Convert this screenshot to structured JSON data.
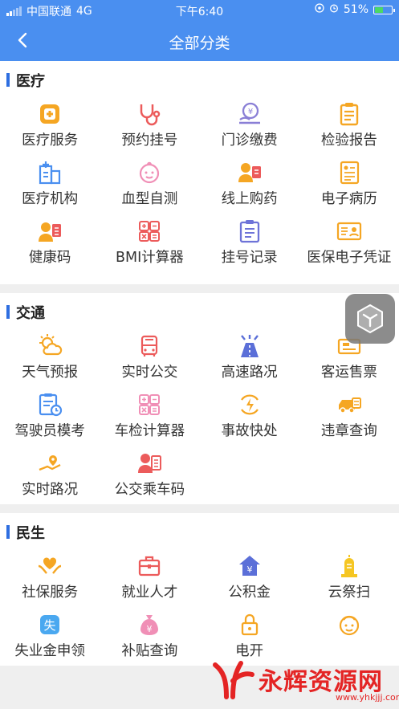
{
  "status": {
    "carrier": "中国联通",
    "network": "4G",
    "time": "下午6:40",
    "battery": "51%",
    "battery_level": 0.51
  },
  "nav": {
    "title": "全部分类"
  },
  "sections": [
    {
      "name": "医疗",
      "items": [
        {
          "label": "医疗服务",
          "icon": "medical-box-icon"
        },
        {
          "label": "预约挂号",
          "icon": "stethoscope-icon"
        },
        {
          "label": "门诊缴费",
          "icon": "payment-icon"
        },
        {
          "label": "检验报告",
          "icon": "report-icon"
        },
        {
          "label": "医疗机构",
          "icon": "hospital-icon"
        },
        {
          "label": "血型自测",
          "icon": "baby-face-icon"
        },
        {
          "label": "线上购药",
          "icon": "pharmacist-icon"
        },
        {
          "label": "电子病历",
          "icon": "record-icon"
        },
        {
          "label": "健康码",
          "icon": "health-code-icon"
        },
        {
          "label": "BMI计算器",
          "icon": "calculator-icon"
        },
        {
          "label": "挂号记录",
          "icon": "clipboard-icon"
        },
        {
          "label": "医保电子凭证",
          "icon": "insurance-card-icon"
        }
      ]
    },
    {
      "name": "交通",
      "items": [
        {
          "label": "天气预报",
          "icon": "weather-icon"
        },
        {
          "label": "实时公交",
          "icon": "bus-icon"
        },
        {
          "label": "高速路况",
          "icon": "highway-icon"
        },
        {
          "label": "客运售票",
          "icon": "ticket-icon"
        },
        {
          "label": "驾驶员模考",
          "icon": "exam-icon"
        },
        {
          "label": "车检计算器",
          "icon": "calculator-icon"
        },
        {
          "label": "事故快处",
          "icon": "accident-icon"
        },
        {
          "label": "违章查询",
          "icon": "car-violation-icon"
        },
        {
          "label": "实时路况",
          "icon": "road-map-icon"
        },
        {
          "label": "公交乘车码",
          "icon": "bus-code-icon"
        }
      ]
    },
    {
      "name": "民生",
      "items": [
        {
          "label": "社保服务",
          "icon": "heart-hands-icon"
        },
        {
          "label": "就业人才",
          "icon": "briefcase-icon"
        },
        {
          "label": "公积金",
          "icon": "housing-fund-icon"
        },
        {
          "label": "云祭扫",
          "icon": "memorial-icon"
        },
        {
          "label": "失业金申领",
          "icon": "unemployment-icon"
        },
        {
          "label": "补贴查询",
          "icon": "money-bag-icon"
        },
        {
          "label": "电开",
          "icon": "lock-icon"
        },
        {
          "label": "",
          "icon": "child-face-icon"
        }
      ]
    }
  ],
  "watermark": {
    "brand": "永辉资源网",
    "url": "www.yhkjjj.com"
  },
  "colors": {
    "primary": "#4a8ff0",
    "orange": "#f5a623",
    "red": "#ec5b5b",
    "blue": "#4a8ff0",
    "pink": "#f08fb6"
  }
}
